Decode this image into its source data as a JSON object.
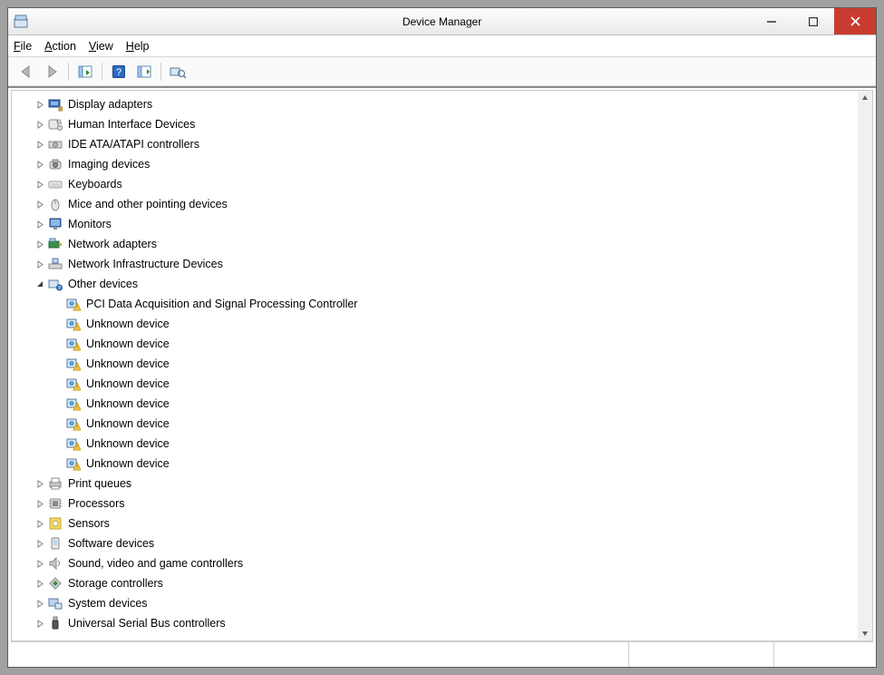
{
  "window": {
    "title": "Device Manager"
  },
  "menu": {
    "file": "File",
    "action": "Action",
    "view": "View",
    "help": "Help",
    "file_u": "F",
    "action_u": "A",
    "view_u": "V",
    "help_u": "H"
  },
  "toolbar": {
    "back": "Back",
    "forward": "Forward",
    "show_hide": "Show/Hide Console Tree",
    "help": "Help",
    "properties": "Properties",
    "scan": "Scan for hardware changes"
  },
  "tree": {
    "nodes": [
      {
        "label": "Display adapters",
        "icon": "display-adapter-icon",
        "expandable": true,
        "expanded": false,
        "indent": 1
      },
      {
        "label": "Human Interface Devices",
        "icon": "hid-icon",
        "expandable": true,
        "expanded": false,
        "indent": 1
      },
      {
        "label": "IDE ATA/ATAPI controllers",
        "icon": "ide-icon",
        "expandable": true,
        "expanded": false,
        "indent": 1
      },
      {
        "label": "Imaging devices",
        "icon": "imaging-icon",
        "expandable": true,
        "expanded": false,
        "indent": 1
      },
      {
        "label": "Keyboards",
        "icon": "keyboard-icon",
        "expandable": true,
        "expanded": false,
        "indent": 1
      },
      {
        "label": "Mice and other pointing devices",
        "icon": "mouse-icon",
        "expandable": true,
        "expanded": false,
        "indent": 1
      },
      {
        "label": "Monitors",
        "icon": "monitor-icon",
        "expandable": true,
        "expanded": false,
        "indent": 1
      },
      {
        "label": "Network adapters",
        "icon": "network-adapter-icon",
        "expandable": true,
        "expanded": false,
        "indent": 1
      },
      {
        "label": "Network Infrastructure Devices",
        "icon": "network-infra-icon",
        "expandable": true,
        "expanded": false,
        "indent": 1
      },
      {
        "label": "Other devices",
        "icon": "other-devices-icon",
        "expandable": true,
        "expanded": true,
        "indent": 1,
        "children": [
          {
            "label": "PCI Data Acquisition and Signal Processing Controller",
            "icon": "unknown-device-warning-icon",
            "indent": 2
          },
          {
            "label": "Unknown device",
            "icon": "unknown-device-warning-icon",
            "indent": 2
          },
          {
            "label": "Unknown device",
            "icon": "unknown-device-warning-icon",
            "indent": 2
          },
          {
            "label": "Unknown device",
            "icon": "unknown-device-warning-icon",
            "indent": 2
          },
          {
            "label": "Unknown device",
            "icon": "unknown-device-warning-icon",
            "indent": 2
          },
          {
            "label": "Unknown device",
            "icon": "unknown-device-warning-icon",
            "indent": 2
          },
          {
            "label": "Unknown device",
            "icon": "unknown-device-warning-icon",
            "indent": 2
          },
          {
            "label": "Unknown device",
            "icon": "unknown-device-warning-icon",
            "indent": 2
          },
          {
            "label": "Unknown device",
            "icon": "unknown-device-warning-icon",
            "indent": 2
          }
        ]
      },
      {
        "label": "Print queues",
        "icon": "printer-icon",
        "expandable": true,
        "expanded": false,
        "indent": 1
      },
      {
        "label": "Processors",
        "icon": "processor-icon",
        "expandable": true,
        "expanded": false,
        "indent": 1
      },
      {
        "label": "Sensors",
        "icon": "sensor-icon",
        "expandable": true,
        "expanded": false,
        "indent": 1
      },
      {
        "label": "Software devices",
        "icon": "software-device-icon",
        "expandable": true,
        "expanded": false,
        "indent": 1
      },
      {
        "label": "Sound, video and game controllers",
        "icon": "sound-icon",
        "expandable": true,
        "expanded": false,
        "indent": 1
      },
      {
        "label": "Storage controllers",
        "icon": "storage-icon",
        "expandable": true,
        "expanded": false,
        "indent": 1
      },
      {
        "label": "System devices",
        "icon": "system-device-icon",
        "expandable": true,
        "expanded": false,
        "indent": 1
      },
      {
        "label": "Universal Serial Bus controllers",
        "icon": "usb-icon",
        "expandable": true,
        "expanded": false,
        "indent": 1
      }
    ]
  }
}
